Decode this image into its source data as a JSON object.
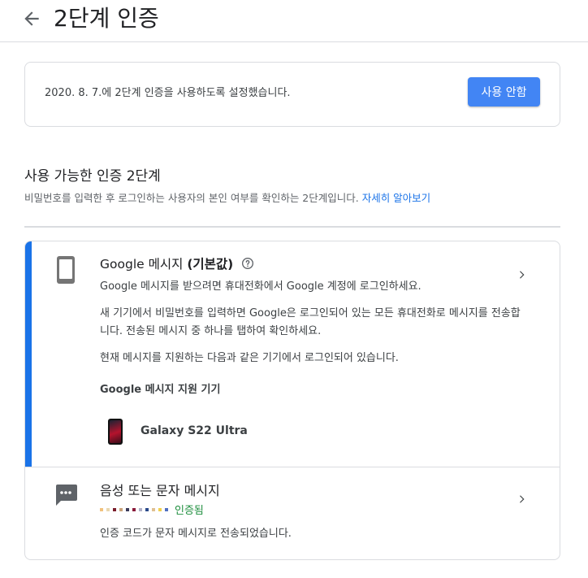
{
  "header": {
    "title": "2단계 인증"
  },
  "status": {
    "text": "2020. 8. 7.에 2단계 인증을 사용하도록 설정했습니다.",
    "disable_label": "사용 안함"
  },
  "section": {
    "title": "사용 가능한 인증 2단계",
    "description": "비밀번호를 입력한 후 로그인하는 사용자의 본인 여부를 확인하는 2단계입니다.",
    "learn_more": "자세히 알아보기"
  },
  "google_prompt": {
    "title_name": "Google 메시지",
    "title_default": "(기본값)",
    "description": "Google 메시지를 받으려면 휴대전화에서 Google 계정에 로그인하세요.",
    "paragraph2": "새 기기에서 비밀번호를 입력하면 Google은 로그인되어 있는 모든 휴대전화로 메시지를 전송합니다. 전송된 메시지 중 하나를 탭하여 확인하세요.",
    "paragraph3": "현재 메시지를 지원하는 다음과 같은 기기에서 로그인되어 있습니다.",
    "devices_heading": "Google 메시지 지원 기기",
    "device_name": "Galaxy S22 Ultra"
  },
  "voice_sms": {
    "title": "음성 또는 문자 메시지",
    "verified_label": "인증됨",
    "description": "인증 코드가 문자 메시지로 전송되었습니다."
  },
  "colors": {
    "accent": "#1a73e8",
    "button": "#4285f4",
    "verified": "#1e8e3e"
  },
  "icons": [
    "back-arrow-icon",
    "smartphone-icon",
    "help-icon",
    "chevron-right-icon",
    "sms-icon"
  ]
}
